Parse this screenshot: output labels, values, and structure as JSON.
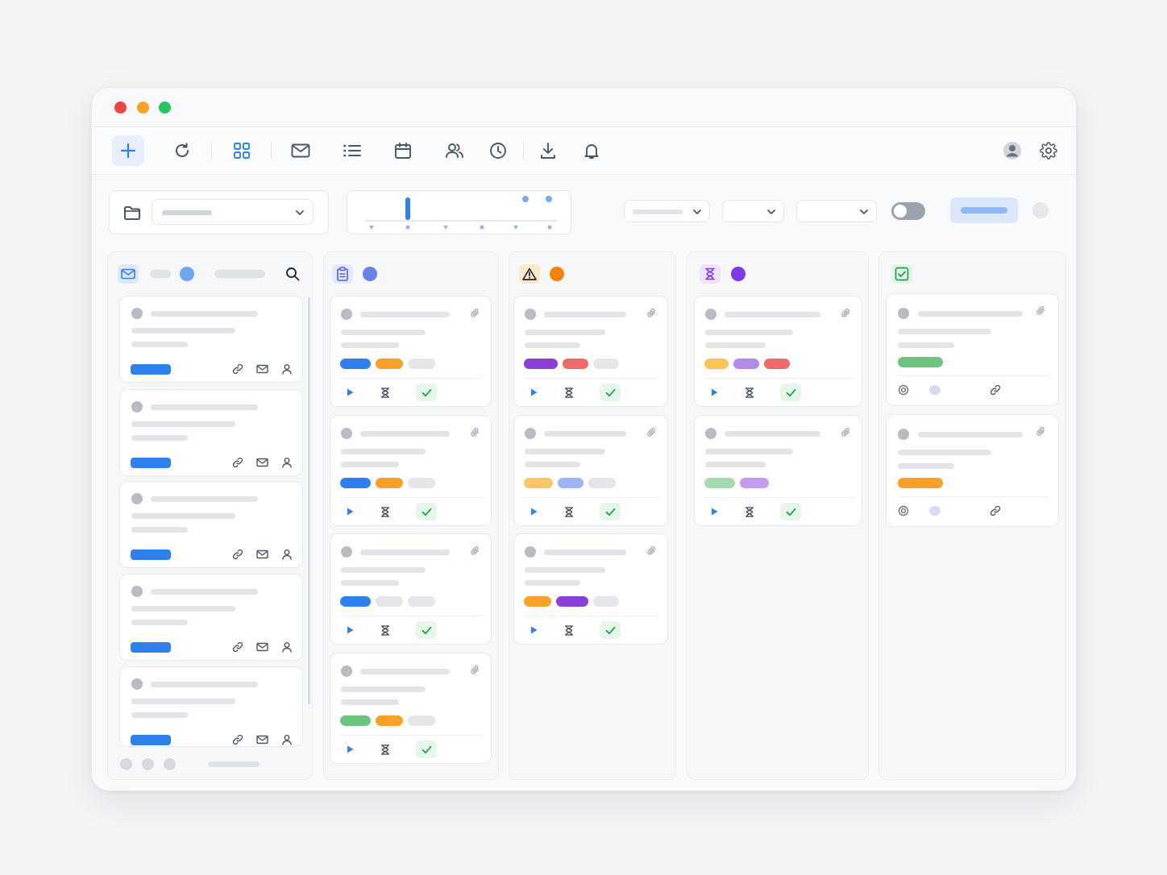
{
  "window": {
    "controls": [
      {
        "name": "close",
        "color": "#ef4444"
      },
      {
        "name": "minimize",
        "color": "#f5a524"
      },
      {
        "name": "maximize",
        "color": "#22c55e"
      }
    ]
  },
  "toolbar": {
    "icons": [
      "plus-icon",
      "refresh-icon",
      "grid-icon",
      "mail-icon",
      "list-icon",
      "calendar-icon",
      "users-icon",
      "clock-icon",
      "download-icon",
      "bell-icon",
      "user-avatar-icon",
      "gear-icon"
    ],
    "active": "plus-icon"
  },
  "filters": {
    "folder_dropdown": "",
    "toggle_on": false,
    "chips": [
      "",
      "",
      ""
    ],
    "primary_button": ""
  },
  "colors": {
    "accent": "#2f80ed",
    "orange": "#f7a02a",
    "purple": "#8b3fd9",
    "red": "#ee6a6a",
    "green": "#6cc47f",
    "yellow": "#f8c455",
    "lavender": "#b38ae6",
    "check_green": "#22a04a"
  },
  "columns": [
    {
      "id": "inbox",
      "icon": "mail-icon",
      "card_count": 5
    },
    {
      "id": "todo",
      "icon": "clipboard-icon",
      "card_count": 4
    },
    {
      "id": "blocked",
      "icon": "warning-icon",
      "card_count": 3
    },
    {
      "id": "waiting",
      "icon": "hourglass-icon",
      "card_count": 2
    },
    {
      "id": "done",
      "icon": "checkbox-icon",
      "card_count": 2
    }
  ],
  "card_actions": [
    "play-icon",
    "hourglass-icon",
    "check-icon"
  ],
  "inbox_actions": [
    "link-icon",
    "mail-icon",
    "user-icon"
  ],
  "done_actions": [
    "target-icon",
    "dot",
    "link-icon"
  ],
  "pagination": {
    "dots": 3
  }
}
